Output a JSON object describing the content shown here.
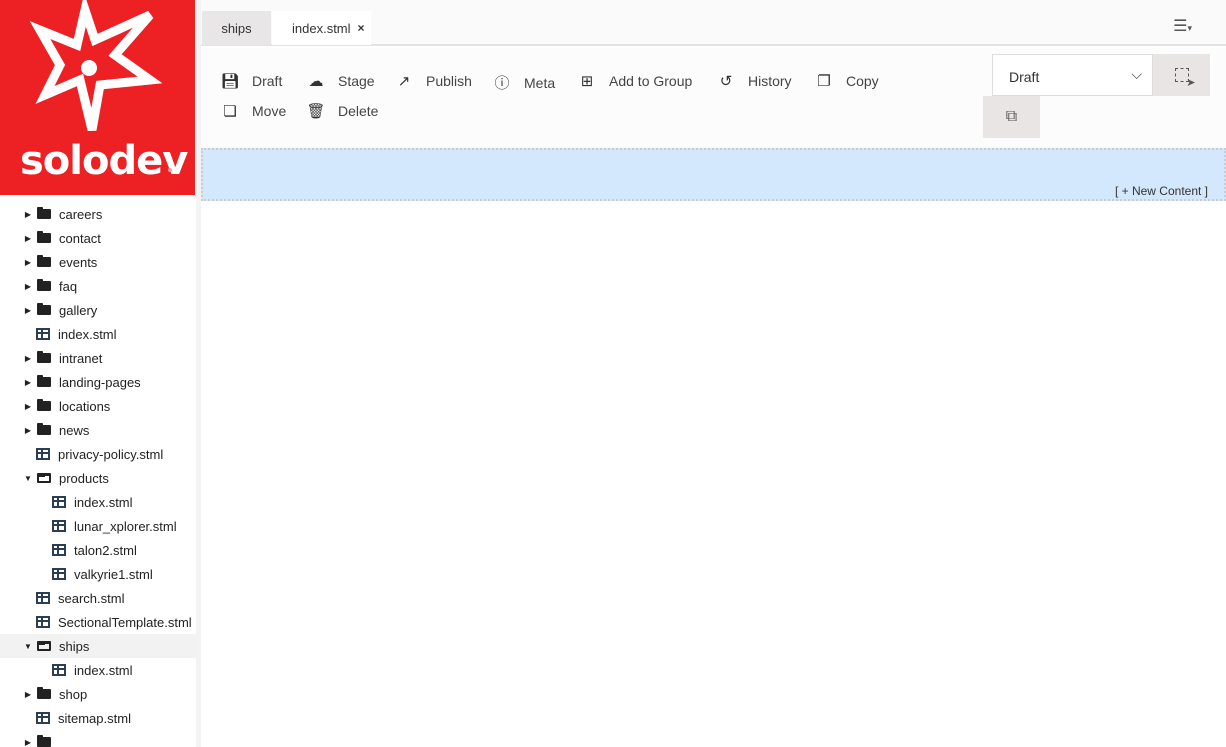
{
  "logo": {
    "text": "solodev"
  },
  "tree": [
    {
      "label": "",
      "type": "folder",
      "level": 0,
      "open": false
    },
    {
      "label": "careers",
      "type": "folder",
      "level": 0,
      "open": false
    },
    {
      "label": "contact",
      "type": "folder",
      "level": 0,
      "open": false
    },
    {
      "label": "events",
      "type": "folder",
      "level": 0,
      "open": false
    },
    {
      "label": "faq",
      "type": "folder",
      "level": 0,
      "open": false
    },
    {
      "label": "gallery",
      "type": "folder",
      "level": 0,
      "open": false
    },
    {
      "label": "index.stml",
      "type": "file",
      "level": 0
    },
    {
      "label": "intranet",
      "type": "folder",
      "level": 0,
      "open": false
    },
    {
      "label": "landing-pages",
      "type": "folder",
      "level": 0,
      "open": false
    },
    {
      "label": "locations",
      "type": "folder",
      "level": 0,
      "open": false
    },
    {
      "label": "news",
      "type": "folder",
      "level": 0,
      "open": false
    },
    {
      "label": "privacy-policy.stml",
      "type": "file",
      "level": 0
    },
    {
      "label": "products",
      "type": "folder",
      "level": 0,
      "open": true
    },
    {
      "label": "index.stml",
      "type": "file",
      "level": 1
    },
    {
      "label": "lunar_xplorer.stml",
      "type": "file",
      "level": 1
    },
    {
      "label": "talon2.stml",
      "type": "file",
      "level": 1
    },
    {
      "label": "valkyrie1.stml",
      "type": "file",
      "level": 1
    },
    {
      "label": "search.stml",
      "type": "file",
      "level": 0
    },
    {
      "label": "SectionalTemplate.stml",
      "type": "file",
      "level": 0
    },
    {
      "label": "ships",
      "type": "folder",
      "level": 0,
      "open": true,
      "selected": true
    },
    {
      "label": "index.stml",
      "type": "file",
      "level": 1
    },
    {
      "label": "shop",
      "type": "folder",
      "level": 0,
      "open": false
    },
    {
      "label": "sitemap.stml",
      "type": "file",
      "level": 0
    },
    {
      "label": "",
      "type": "folder",
      "level": 0,
      "open": false
    }
  ],
  "tabs": [
    {
      "label": "ships"
    },
    {
      "label": "index.stml",
      "close": "×"
    }
  ],
  "menu_icon": "hamburger-menu-icon",
  "toolbar": {
    "draft": "Draft",
    "stage": "Stage",
    "publish": "Publish",
    "meta": "Meta",
    "add_to_group": "Add to Group",
    "history": "History",
    "copy": "Copy",
    "move": "Move",
    "delete": "Delete"
  },
  "status_select": {
    "value": "Draft"
  },
  "new_content": "[ + New Content ]",
  "colors": {
    "brand": "#ed2024",
    "drop_zone": "#d3e8fd"
  }
}
